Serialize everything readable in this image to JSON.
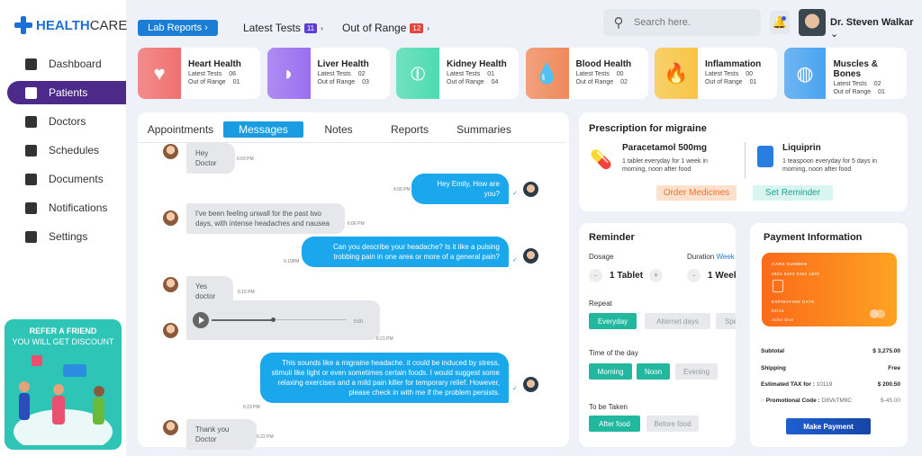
{
  "brand": {
    "name_a": "HEALTH",
    "name_b": "CARE"
  },
  "sidebar": {
    "items": [
      {
        "label": "Dashboard"
      },
      {
        "label": "Patients",
        "active": true
      },
      {
        "label": "Doctors"
      },
      {
        "label": "Schedules"
      },
      {
        "label": "Documents"
      },
      {
        "label": "Notifications"
      },
      {
        "label": "Settings"
      }
    ],
    "refer": {
      "title": "REFER A FRIEND",
      "subtitle": "YOU WILL GET DISCOUNT"
    }
  },
  "topbar": {
    "lab_reports": "Lab Reports",
    "latest_tests": "Latest Tests",
    "latest_count": "11",
    "out_of_range": "Out of Range",
    "out_count": "12",
    "search_placeholder": "Search here.",
    "user": "Dr. Steven Walkar"
  },
  "categories": [
    {
      "name": "Heart Health",
      "latest": "06",
      "out": "01",
      "color": "#f07070",
      "icon": "heart-icon"
    },
    {
      "name": "Liver Health",
      "latest": "02",
      "out": "03",
      "color": "#9a6ff0",
      "icon": "liver-icon"
    },
    {
      "name": "Kidney Health",
      "latest": "01",
      "out": "04",
      "color": "#4ddbb0",
      "icon": "kidney-icon"
    },
    {
      "name": "Blood Health",
      "latest": "00",
      "out": "02",
      "color": "#ee8a5c",
      "icon": "blood-drop-icon"
    },
    {
      "name": "Inflammation",
      "latest": "00",
      "out": "01",
      "color": "#f7c545",
      "icon": "flame-icon"
    },
    {
      "name": "Muscles & Bones",
      "latest": "02",
      "out": "01",
      "color": "#4aa3f0",
      "icon": "muscle-icon"
    }
  ],
  "labels": {
    "latest": "Latest Tests",
    "out": "Out of Range"
  },
  "chat": {
    "tabs": [
      "Appointments",
      "Messages",
      "Notes",
      "Reports",
      "Summaries"
    ],
    "active_tab": "Messages",
    "messages": [
      {
        "from": "patient",
        "text": "Hey Doctor",
        "time": "6:03 PM"
      },
      {
        "from": "doctor",
        "text": "Hey Emily, How are you?",
        "time": "6:05 PM"
      },
      {
        "from": "patient",
        "text": "I've been feeling unwall for the past two days, with intense headaches and nausea",
        "time": "6:06 PM"
      },
      {
        "from": "doctor",
        "text": "Can you describe your headache? Is it like a pulsing trobbing pain in one area or more of a general pain?",
        "time": "6:10PM"
      },
      {
        "from": "patient",
        "text": "Yes doctor",
        "time": "6:15 PM"
      },
      {
        "from": "patient",
        "audio_duration": "5:50",
        "audio_progress": 0.45,
        "time": "6:21 PM"
      },
      {
        "from": "doctor",
        "text": "This sounds like a migraine headache. it could be induced by stress, stimuli like light or even sometimes certain foods. I would suggest some relaxing exercises and a mild pain killer for temporary relief. However, please check in with me if the problem persists.",
        "time": "6:23 PM"
      },
      {
        "from": "patient",
        "text": "Thank you Doctor",
        "time": "6:22 PM"
      }
    ]
  },
  "prescription": {
    "title": "Prescription for migraine",
    "meds": [
      {
        "name": "Paracetamol 500mg",
        "desc": "1 tablet everyday for 1 week in morning, noon after food"
      },
      {
        "name": "Liquiprin",
        "desc": "1 teaspoon everyday for 5 days in morning, noon after food"
      }
    ],
    "order": "Order Medicines",
    "reminder": "Set Reminder"
  },
  "reminder": {
    "title": "Reminder",
    "dosage_label": "Dosage",
    "dosage": "1 Tablet",
    "duration_label": "Duration",
    "duration_unit": "Week",
    "duration": "1 Week",
    "repeat_label": "Repeat",
    "repeat": [
      "Everyday",
      "Alternet days",
      "Spe"
    ],
    "time_label": "Time of the day",
    "times": [
      "Morning",
      "Noon",
      "Evening"
    ],
    "taken_label": "To be Taken",
    "taken": [
      "After food",
      "Before food"
    ],
    "minus": "-",
    "plus": "+"
  },
  "payment": {
    "title": "Payment Information",
    "card": {
      "number_label": "CARD NUMBER",
      "number": "4824 5403 9382 1800",
      "exp_label": "EXPIRATION DATE",
      "exp": "03/24",
      "holder": "John Doe"
    },
    "subtotal_label": "Subtotal",
    "subtotal": "$ 3,275.00",
    "shipping_label": "Shipping",
    "shipping": "Free",
    "tax_label": "Estimated TAX for :",
    "tax_zip": "10119",
    "tax": "$ 200.50",
    "promo_label": "Promotional Code :",
    "promo_code": "D8VkTM9C",
    "promo": "$-45.00",
    "button": "Make  Payment"
  }
}
